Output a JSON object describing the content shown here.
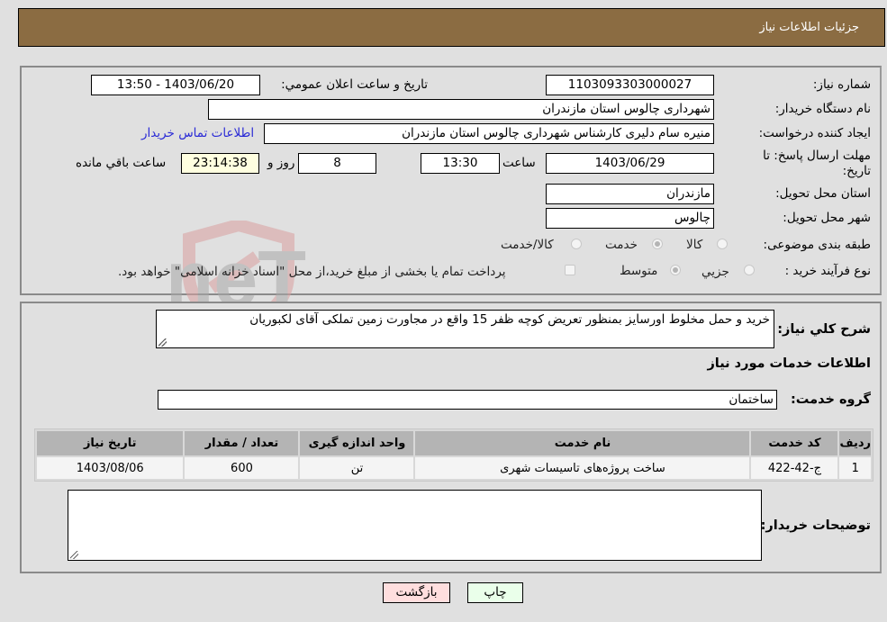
{
  "header": {
    "title": "جزئیات اطلاعات نیاز"
  },
  "details": {
    "need_number_label": "شماره نیاز:",
    "need_number": "1103093303000027",
    "announce_label": "تاریخ و ساعت اعلان عمومي:",
    "announce_value": "1403/06/20 - 13:50",
    "buyer_org_label": "نام دستگاه خریدار:",
    "buyer_org": "شهرداری چالوس استان مازندران",
    "creator_label": "ایجاد کننده درخواست:",
    "creator": "منیره سام دلیری کارشناس شهرداری چالوس استان مازندران",
    "contact_link": "اطلاعات تماس خریدار",
    "deadline_label": "مهلت ارسال پاسخ: تا تاریخ:",
    "deadline_date": "1403/06/29",
    "time_label": "ساعت",
    "deadline_time": "13:30",
    "days_value": "8",
    "days_label": "روز و",
    "remaining_time": "23:14:38",
    "remaining_label": "ساعت باقي مانده",
    "province_label": "استان محل تحویل:",
    "province": "مازندران",
    "city_label": "شهر محل تحویل:",
    "city": "چالوس",
    "category_label": "طبقه بندی موضوعی:",
    "category_options": [
      {
        "label": "کالا",
        "checked": false
      },
      {
        "label": "خدمت",
        "checked": true
      },
      {
        "label": "کالا/خدمت",
        "checked": false
      }
    ],
    "process_label": "نوع فرآیند خرید :",
    "process_options": [
      {
        "label": "جزيي",
        "checked": false
      },
      {
        "label": "متوسط",
        "checked": true
      }
    ],
    "treasury_checkbox_label": "پرداخت تمام یا بخشی از مبلغ خرید،از محل \"اسناد خزانه اسلامی\" خواهد بود."
  },
  "description": {
    "label": "شرح کلي نیاز:",
    "value": "خرید و حمل مخلوط اورسایز بمنظور تعریض کوچه ظفر 15 واقع در مجاورت زمین تملکی آقای لکبوریان"
  },
  "services": {
    "section_title": "اطلاعات خدمات مورد نیاز",
    "group_label": "گروه خدمت:",
    "group_value": "ساختمان",
    "columns": [
      "ردیف",
      "کد خدمت",
      "نام خدمت",
      "واحد اندازه گیری",
      "تعداد / مقدار",
      "تاریخ نیاز"
    ],
    "rows": [
      {
        "row": "1",
        "code": "ج-42-422",
        "name": "ساخت پروژه‌های تاسیسات شهری",
        "unit": "تن",
        "qty": "600",
        "date": "1403/08/06"
      }
    ]
  },
  "buyer_notes": {
    "label": "توضیحات خریدار:",
    "value": ""
  },
  "buttons": {
    "print": "چاپ",
    "back": "بازگشت"
  },
  "watermark": {
    "text": "AriaTender.neT"
  }
}
